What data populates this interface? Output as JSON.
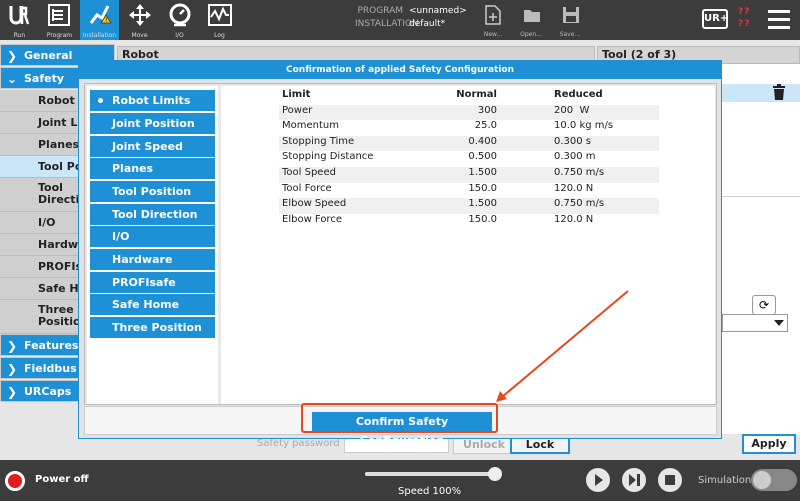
{
  "topbar": {
    "nav": [
      {
        "name": "run",
        "label": "Run"
      },
      {
        "name": "program",
        "label": "Program"
      },
      {
        "name": "installation",
        "label": "Installation"
      },
      {
        "name": "move",
        "label": "Move"
      },
      {
        "name": "io",
        "label": "I/O"
      },
      {
        "name": "log",
        "label": "Log"
      }
    ],
    "program_key": "PROGRAM",
    "program_value": "<unnamed>",
    "installation_key": "INSTALLATION",
    "installation_value": "default*",
    "file_buttons": [
      "New...",
      "Open...",
      "Save..."
    ],
    "urplus_label": "UR+",
    "warning_marks": "??\n??",
    "accent_color": "#1e90d6"
  },
  "leftnav": {
    "general": "General",
    "safety": "Safety",
    "safety_items": [
      "Robot L",
      "Joint Li",
      "Planes",
      "Tool Po",
      "Tool\nDirecti",
      "I/O",
      "Hardwa",
      "PROFIs",
      "Safe Ho",
      "Three\nPositio"
    ],
    "features": "Features",
    "fieldbus": "Fieldbus",
    "urcaps": "URCaps"
  },
  "background": {
    "robot_header": "Robot",
    "tool_header": "Tool (2 of 3)",
    "password_label": "Safety password",
    "unlock_label": "Unlock",
    "lock_label": "Lock",
    "apply_label": "Apply"
  },
  "dialog": {
    "title": "Confirmation of applied Safety Configuration",
    "tabs": [
      "Robot Limits",
      "Joint Position",
      "Joint Speed",
      "Planes",
      "Tool Position",
      "Tool Direction",
      "I/O",
      "Hardware",
      "PROFIsafe",
      "Safe Home",
      "Three Position"
    ],
    "selected_tab": "Robot Limits",
    "table_headers": {
      "limit": "Limit",
      "normal": "Normal",
      "reduced": "Reduced"
    },
    "rows": [
      {
        "limit": "Power",
        "normal": "300",
        "reduced": "200  W"
      },
      {
        "limit": "Momentum",
        "normal": "25.0",
        "reduced": "10.0 kg m/s"
      },
      {
        "limit": "Stopping Time",
        "normal": "0.400",
        "reduced": "0.300 s"
      },
      {
        "limit": "Stopping Distance",
        "normal": "0.500",
        "reduced": "0.300 m"
      },
      {
        "limit": "Tool Speed",
        "normal": "1.500",
        "reduced": "0.750 m/s"
      },
      {
        "limit": "Tool Force",
        "normal": "150.0",
        "reduced": "120.0 N"
      },
      {
        "limit": "Elbow Speed",
        "normal": "1.500",
        "reduced": "0.750 m/s"
      },
      {
        "limit": "Elbow Force",
        "normal": "150.0",
        "reduced": "120.0 N"
      }
    ],
    "confirm_label": "Confirm Safety Configuration",
    "highlight_color": "#e8461e"
  },
  "bottombar": {
    "power_label": "Power off",
    "speed_label": "Speed 100%",
    "speed_fraction": 1.0,
    "simulation_label": "Simulation"
  }
}
